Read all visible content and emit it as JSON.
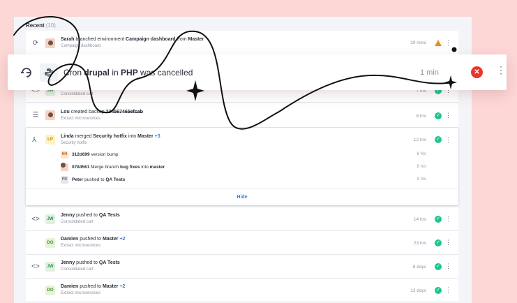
{
  "recent": {
    "label": "Recent",
    "count": "(10)"
  },
  "rows": [
    {
      "title_parts": [
        "Sarah",
        " branched environment ",
        "Campaign dashboard",
        " from ",
        "Master"
      ],
      "sub": "Campaign dashboard",
      "time": "29 mins"
    },
    {
      "sub": "Consolidated cart",
      "time": "7 hrs"
    },
    {
      "title_parts": [
        "Lou",
        " created backup ",
        "234567465efcab"
      ],
      "sub": "Extract microservices",
      "time": "8 hrs"
    },
    {
      "avatar": "LP",
      "title_parts": [
        "Linda",
        " merged ",
        "Security hotfix",
        " into ",
        "Master",
        " +3"
      ],
      "sub": "Security hotfix",
      "time": "12 hrs"
    },
    {
      "avatar": "JW",
      "title_parts": [
        "Jenny",
        " pushed to ",
        "QA Tests"
      ],
      "sub": "Consolidated cart",
      "time": "14 hrs"
    },
    {
      "avatar": "DO",
      "title_parts": [
        "Damien",
        " pushed to ",
        "Master",
        " +2"
      ],
      "sub": "Extract microservices",
      "time": "23 hrs"
    },
    {
      "avatar": "JW",
      "title_parts": [
        "Jenny",
        " pushed to ",
        "QA Tests"
      ],
      "sub": "Consolidated cart",
      "time": "8 days"
    },
    {
      "avatar": "DO",
      "title_parts": [
        "Damien",
        " pushed to ",
        "Master",
        " +2"
      ],
      "sub": "Extract microservices",
      "time": "12 days"
    }
  ],
  "avatars": {
    "jw": "JW"
  },
  "expanded": {
    "items": [
      {
        "avatar": "NH",
        "hash": "312d699",
        "text": " version bump",
        "time": "8 hrs"
      },
      {
        "hash": "0784561",
        "text_parts": [
          " Merge branch ",
          "bug fixes",
          " into ",
          "master"
        ],
        "time": "8 hrs"
      },
      {
        "avatar": "PR",
        "text_parts": [
          "Peter",
          " pushed to ",
          "QA Tests"
        ],
        "time": "9 hrs"
      }
    ],
    "hide_label": "Hide"
  },
  "toast": {
    "parts": [
      "Cron ",
      "drupal",
      " in ",
      "PHP",
      " was cancelled"
    ],
    "time": "1 min"
  },
  "colors": {
    "background": "#fdd6d6",
    "success": "#1fc58f",
    "warning": "#f08a24",
    "danger": "#e8362f",
    "link": "#3b7ddd"
  }
}
